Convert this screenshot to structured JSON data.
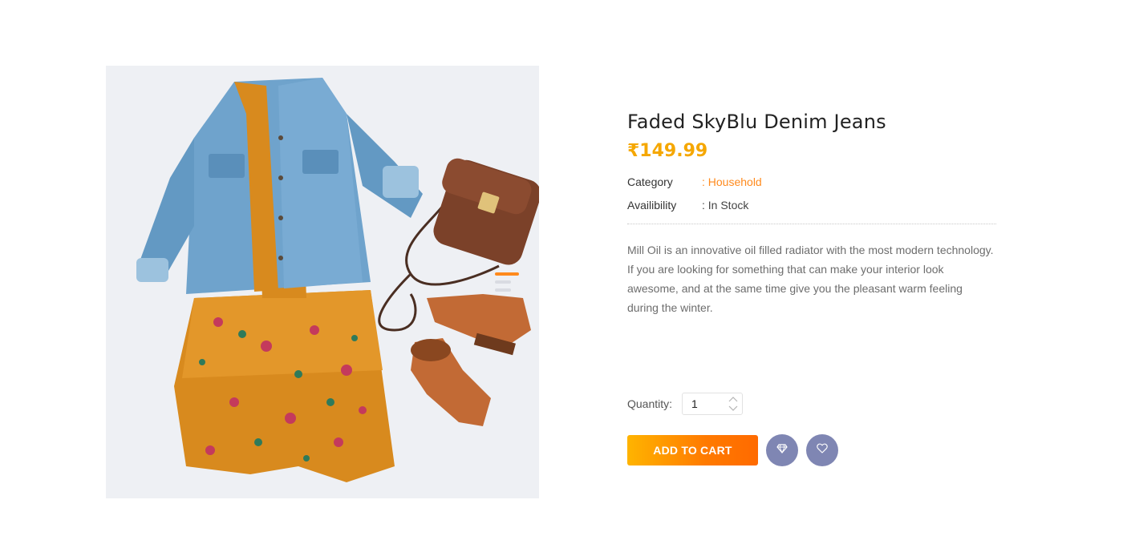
{
  "product": {
    "image_alt": "Denim jacket, floral dress, brown bag and boots flat lay",
    "title": "Faded SkyBlu Denim Jeans",
    "price": "₹149.99",
    "meta": {
      "category_label": "Category",
      "category_value": ": Household",
      "availability_label": "Availibility",
      "availability_value": ": In Stock"
    },
    "description": "Mill Oil is an innovative oil filled radiator with the most modern technology. If you are looking for something that can make your interior look awesome, and at the same time give you the pleasant warm feeling during the winter."
  },
  "quantity": {
    "label": "Quantity:",
    "value": "1"
  },
  "actions": {
    "add_to_cart_label": "ADD TO CART",
    "compare_icon": "diamond-icon",
    "wishlist_icon": "heart-icon"
  },
  "colors": {
    "price": "#f5a700",
    "category_link": "#ff8a1d",
    "button_gradient_start": "#ffb400",
    "button_gradient_end": "#ff6a00",
    "round_button": "#7f86b3"
  }
}
